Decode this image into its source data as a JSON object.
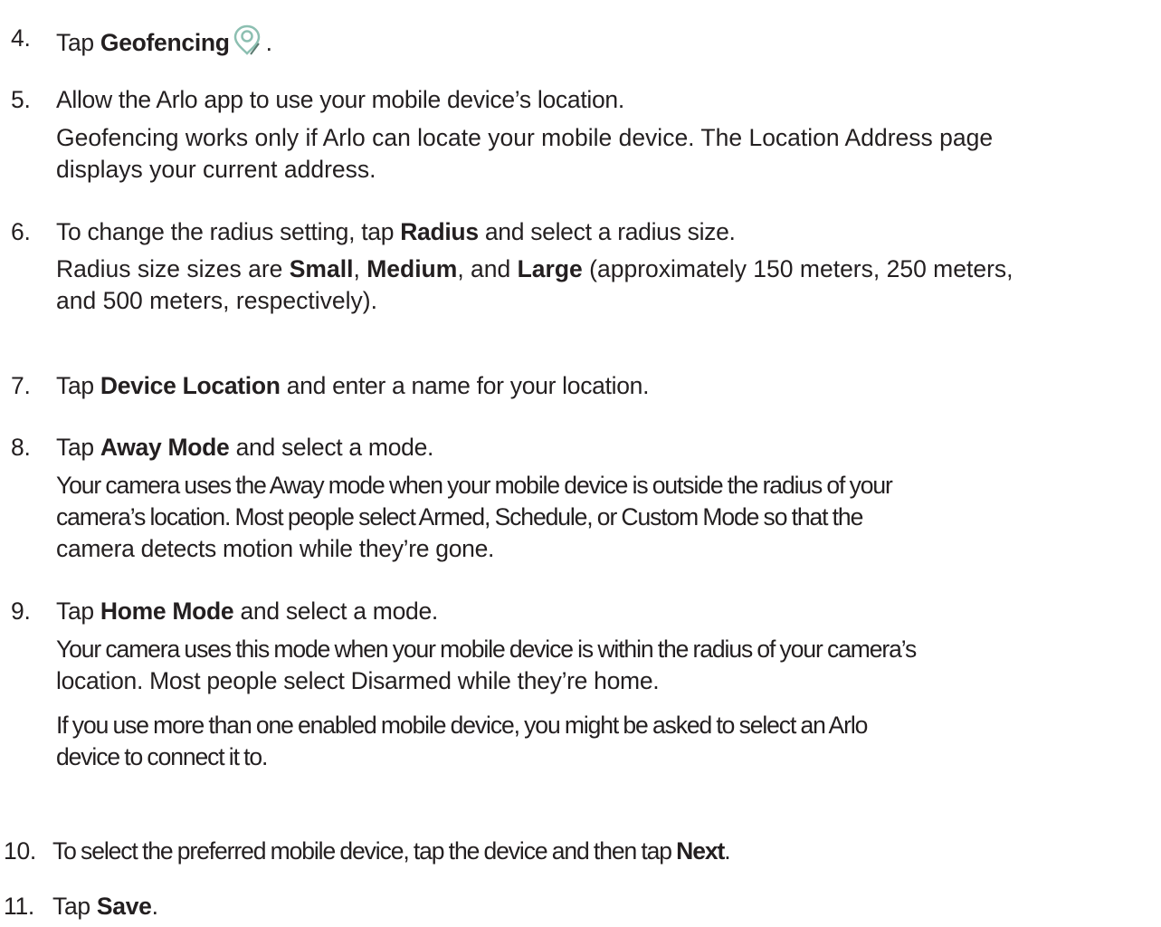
{
  "steps": [
    {
      "number": "4.",
      "parts": [
        "Tap ",
        "Geofencing",
        "."
      ],
      "icon": "location-pin-icon"
    },
    {
      "number": "5.",
      "text": "Allow the Arlo app to use your mobile device’s location.",
      "detail": [
        "Geofencing works only if Arlo can locate your mobile device. The Location Address page",
        "displays your current address."
      ]
    },
    {
      "number": "6.",
      "parts": [
        "To change the radius setting, tap ",
        "Radius",
        " and select a radius size."
      ],
      "detail_parts": [
        "Radius size sizes are ",
        "Small",
        ", ",
        "Medium",
        ", and ",
        "Large",
        " (approximately 150 meters, 250 meters,"
      ],
      "detail_line2": "and 500 meters, respectively)."
    },
    {
      "number": "7.",
      "parts": [
        "Tap ",
        "Device Location",
        " and enter a name for your location."
      ]
    },
    {
      "number": "8.",
      "parts": [
        "Tap ",
        "Away Mode",
        " and select a mode."
      ],
      "detail": [
        "Your camera uses the Away mode when your mobile device is outside the radius of your",
        "camera’s location. Most people select Armed, Schedule, or Custom Mode so that the",
        "camera detects motion while they’re gone."
      ]
    },
    {
      "number": "9.",
      "parts": [
        "Tap ",
        "Home Mode",
        " and select a mode."
      ],
      "detail": [
        "Your camera uses this mode when your mobile device is within the radius of your camera’s",
        "location. Most people select Disarmed while they’re home."
      ],
      "detail2": [
        "If you use more than one enabled mobile device, you might be asked to select an Arlo",
        "device to connect it to."
      ]
    },
    {
      "number": "10.",
      "parts": [
        "To select the preferred mobile device, tap the device and then tap ",
        "Next",
        "."
      ]
    },
    {
      "number": "11.",
      "parts": [
        "Tap ",
        "Save",
        "."
      ]
    }
  ]
}
